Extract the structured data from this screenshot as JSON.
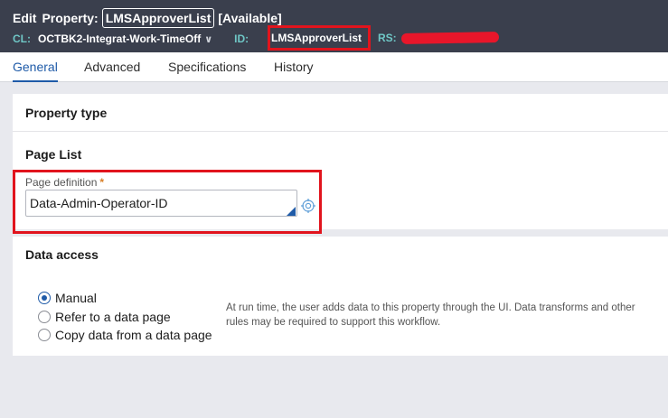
{
  "header": {
    "edit_label": "Edit",
    "property_label": "Property:",
    "property_name": "LMSApproverList",
    "status": "[Available]",
    "class_key": "CL:",
    "class_value": "OCTBK2-Integrat-Work-TimeOff",
    "chevron": "∨",
    "id_key": "ID:",
    "id_value": "LMSApproverList",
    "rs_key": "RS:"
  },
  "tabs": [
    {
      "label": "General",
      "active": true
    },
    {
      "label": "Advanced",
      "active": false
    },
    {
      "label": "Specifications",
      "active": false
    },
    {
      "label": "History",
      "active": false
    }
  ],
  "property_type": {
    "title": "Property type",
    "subtitle": "Page List",
    "field_label": "Page definition",
    "required_mark": "*",
    "field_value": "Data-Admin-Operator-ID"
  },
  "data_access": {
    "title": "Data access",
    "options": [
      {
        "label": "Manual",
        "checked": true
      },
      {
        "label": "Refer to a data page",
        "checked": false
      },
      {
        "label": "Copy data from a data page",
        "checked": false
      }
    ],
    "help_text": "At run time, the user adds data to this property through the UI. Data transforms and other rules may be required to support this workflow."
  },
  "colors": {
    "header_bg": "#3a3f4d",
    "accent": "#1f5ba8",
    "label_teal": "#6fc7c6",
    "highlight_red": "#e1141d"
  }
}
